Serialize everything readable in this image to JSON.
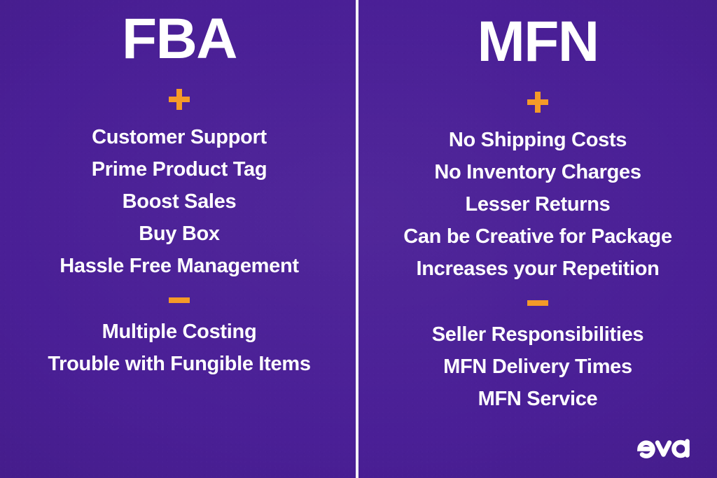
{
  "theme": {
    "background_purple": "#4a1f96",
    "accent_orange": "#f59a28",
    "text_white": "#ffffff",
    "divider_white": "#f3f1f7"
  },
  "columns": [
    {
      "heading": "FBA",
      "pros_icon": "plus-icon",
      "cons_icon": "minus-icon",
      "pros": [
        "Customer Support",
        "Prime Product Tag",
        "Boost Sales",
        "Buy Box",
        "Hassle Free Management"
      ],
      "cons": [
        "Multiple Costing",
        "Trouble with Fungible Items"
      ]
    },
    {
      "heading": "MFN",
      "pros_icon": "plus-icon",
      "cons_icon": "minus-icon",
      "pros": [
        "No Shipping Costs",
        "No Inventory Charges",
        "Lesser Returns",
        "Can be Creative for Package",
        "Increases your Repetition"
      ],
      "cons": [
        "Seller Responsibilities",
        "MFN Delivery Times",
        "MFN Service"
      ]
    }
  ],
  "logo": {
    "name": "eva",
    "alt": "eva logo"
  }
}
